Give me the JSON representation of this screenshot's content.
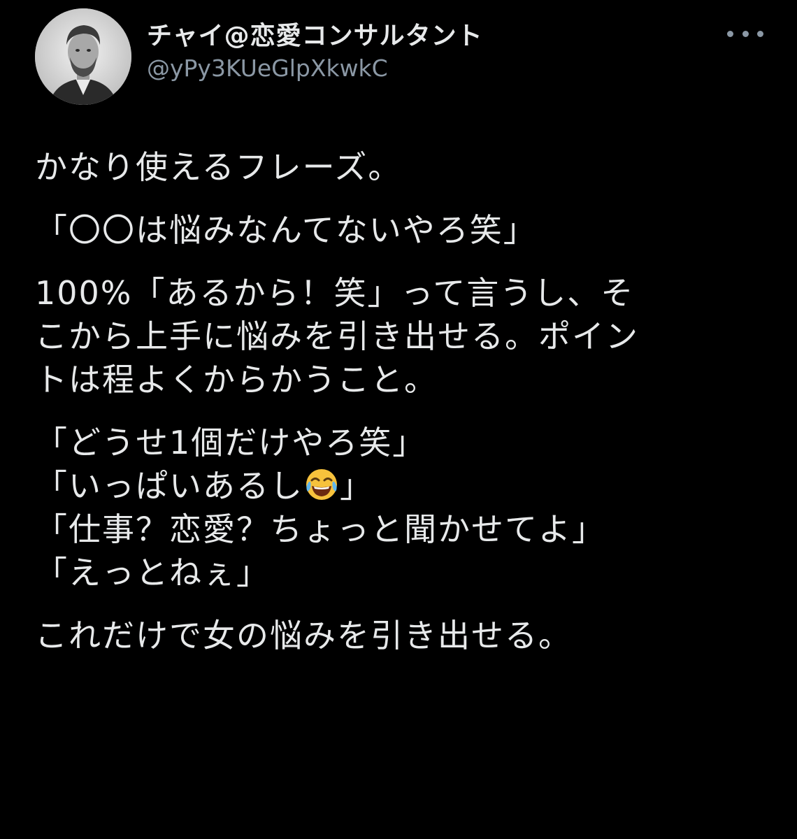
{
  "tweet": {
    "author": {
      "display_name": "チャイ@恋愛コンサルタント",
      "handle": "@yPy3KUeGlpXkwkC",
      "avatar": "portrait-photo"
    },
    "more_icon": "more-horizontal-icon",
    "body": {
      "p1": "かなり使えるフレーズ。",
      "p2": "「〇〇は悩みなんてないやろ笑」",
      "p3_lines": [
        "100%「あるから！笑」って言うし、そ",
        "こから上手に悩みを引き出せる。ポイン",
        "トは程よくからかうこと。"
      ],
      "quotes": {
        "q1": "「どうせ1個だけやろ笑」",
        "q2_before": "「いっぱいあるし",
        "q2_emoji": "face-with-tears-of-joy",
        "q2_after": "」",
        "q3": "「仕事？恋愛？ちょっと聞かせてよ」",
        "q4": "「えっとねぇ」"
      },
      "p5": "これだけで女の悩みを引き出せる。"
    }
  },
  "colors": {
    "background": "#000000",
    "text_primary": "#e7e9ea",
    "text_secondary": "#8b98a5"
  }
}
